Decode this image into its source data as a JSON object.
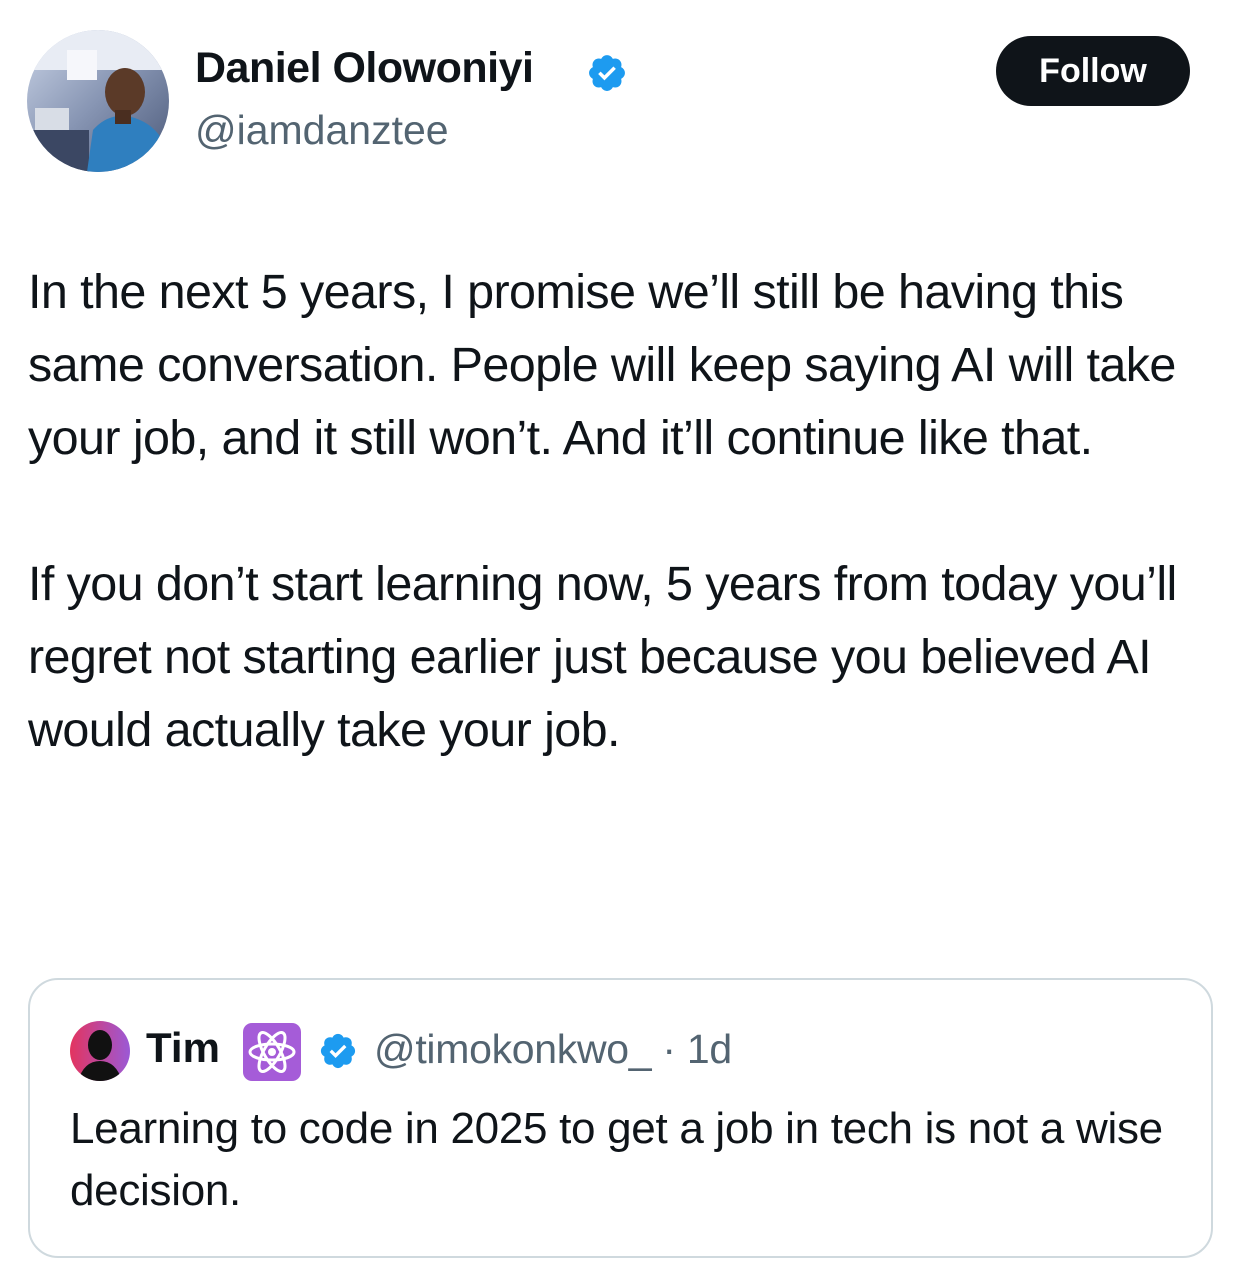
{
  "author": {
    "display_name": "Daniel Olowoniyi",
    "handle": "@iamdanztee",
    "verified": true
  },
  "follow_button_label": "Follow",
  "tweet": {
    "paragraphs": [
      "In the next 5 years, I promise we’ll still be having this same conversation. People will keep saying AI will take your job, and it still won’t. And it’ll continue like that.",
      "If you don’t start learning now, 5 years from today you’ll regret not starting earlier just because you believed AI would actually take your job."
    ]
  },
  "quote": {
    "display_name": "Tim",
    "badge_icon": "atom-emoji-icon",
    "verified": true,
    "handle_time": "@timokonkwo_ · 1d",
    "text": "Learning to code in 2025 to get a job in tech is not a wise decision."
  },
  "colors": {
    "text": "#0f1419",
    "secondary_text": "#536471",
    "verified_blue": "#1d9bf0",
    "follow_bg": "#0f1419",
    "card_border": "#cfd9de"
  }
}
